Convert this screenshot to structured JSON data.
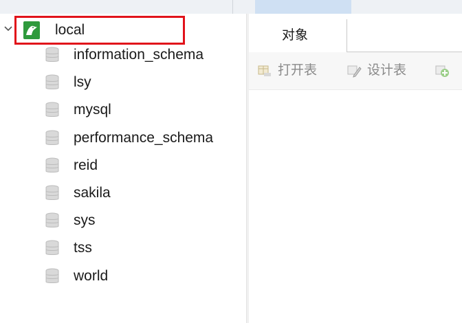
{
  "connection": {
    "name": "local",
    "expanded": true
  },
  "databases": [
    "information_schema",
    "lsy",
    "mysql",
    "performance_schema",
    "reid",
    "sakila",
    "sys",
    "tss",
    "world"
  ],
  "right_panel": {
    "tab_label": "对象",
    "toolbar": {
      "open_table": "打开表",
      "design_table": "设计表"
    }
  },
  "colors": {
    "highlight": "#e1121a",
    "tab_selected": "#cfe0f3",
    "connection_icon": "#2e9a3c"
  }
}
